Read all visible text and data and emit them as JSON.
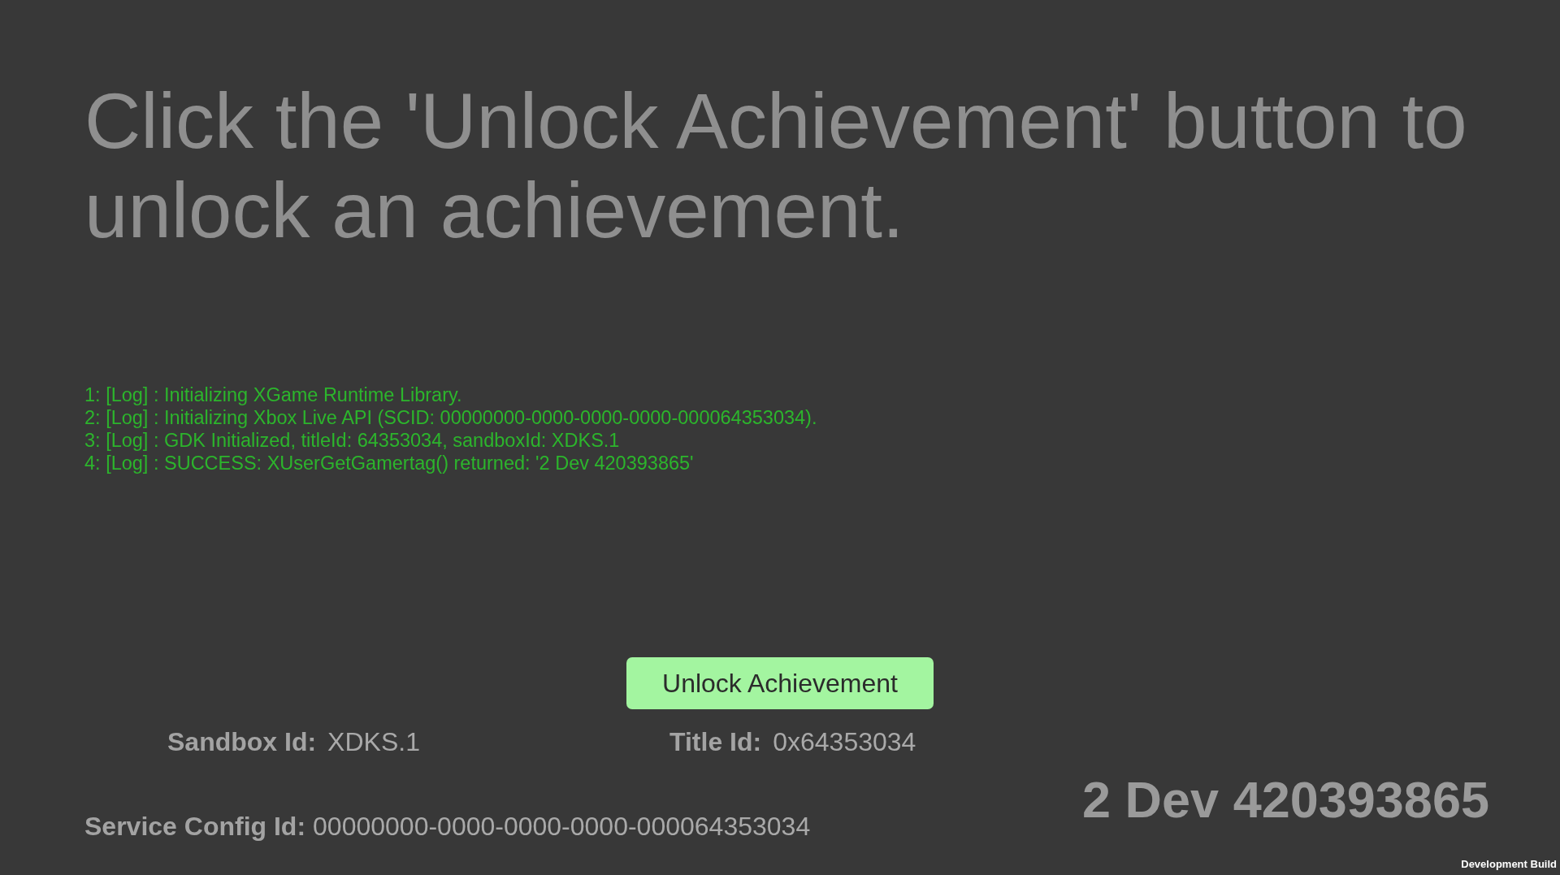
{
  "instruction": "Click the 'Unlock Achievement' button to unlock an achievement.",
  "log": {
    "lines": [
      "1: [Log] : Initializing XGame Runtime Library.",
      "2: [Log] : Initializing Xbox Live API (SCID: 00000000-0000-0000-0000-000064353034).",
      "3: [Log] : GDK Initialized, titleId: 64353034, sandboxId: XDKS.1",
      "4: [Log] : SUCCESS: XUserGetGamertag() returned: '2 Dev 420393865'"
    ]
  },
  "unlock_button": {
    "label": "Unlock Achievement"
  },
  "ids": [
    {
      "label": "Sandbox Id:",
      "value": "XDKS.1"
    },
    {
      "label": "Title Id:",
      "value": "0x64353034"
    }
  ],
  "service_config": {
    "label": "Service Config Id:",
    "value": "00000000-0000-0000-0000-000064353034"
  },
  "gamertag": "2 Dev 420393865",
  "build_label": "Development Build"
}
